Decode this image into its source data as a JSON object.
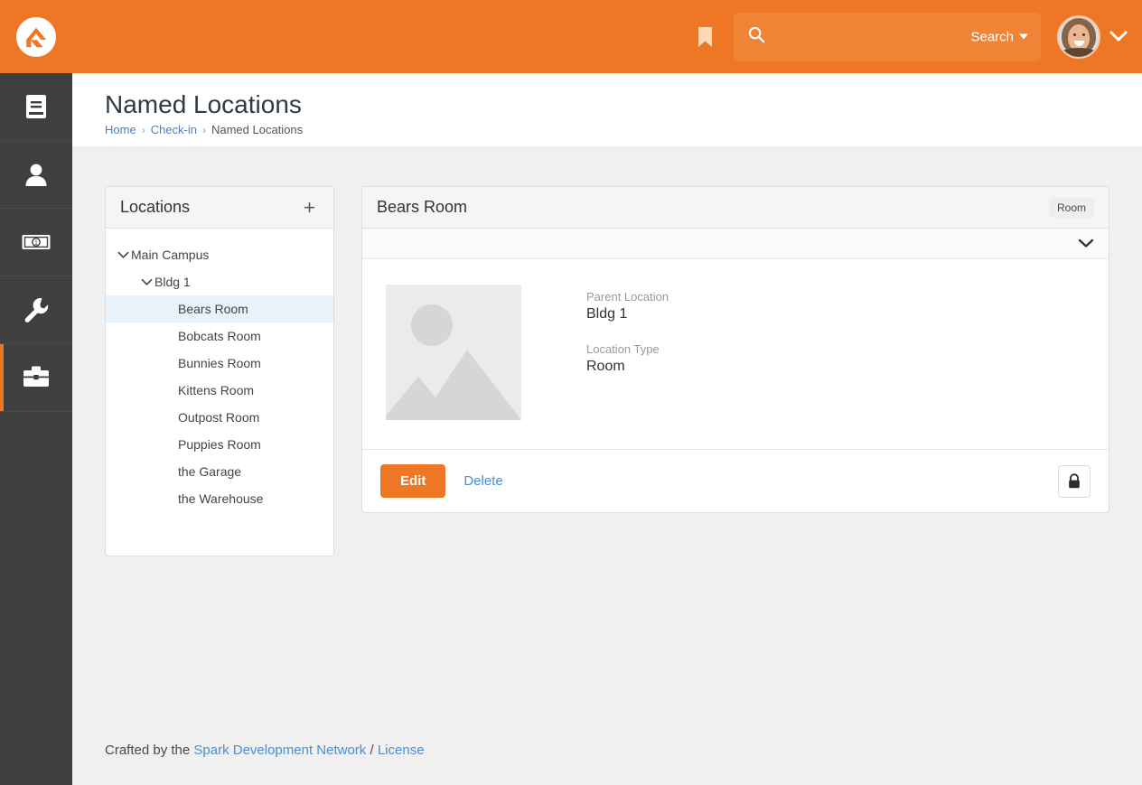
{
  "topbar": {
    "logo_icon": "rock-rms-logo",
    "bookmark_icon": "bookmark-icon",
    "search": {
      "icon": "search-icon",
      "value": "",
      "placeholder": "",
      "dropdown_label": "Search"
    },
    "avatar_alt": "user-avatar",
    "accent_color": "#ee7725",
    "search_field_color": "#ef8436"
  },
  "sidebar": {
    "items": [
      {
        "icon": "book-icon",
        "name": "dashboard",
        "active": false
      },
      {
        "icon": "person-icon",
        "name": "people",
        "active": false
      },
      {
        "icon": "money-bill-icon",
        "name": "finance",
        "active": false
      },
      {
        "icon": "wrench-icon",
        "name": "admin",
        "active": false
      },
      {
        "icon": "toolbox-icon",
        "name": "tools",
        "active": true
      }
    ]
  },
  "page": {
    "title": "Named Locations",
    "breadcrumb": [
      {
        "label": "Home",
        "link": true
      },
      {
        "label": "Check-in",
        "link": true
      },
      {
        "label": "Named Locations",
        "link": false
      }
    ],
    "breadcrumb_separator": "›"
  },
  "tree_panel": {
    "title": "Locations",
    "add_label": "+",
    "nodes": [
      {
        "label": "Main Campus",
        "level": 0,
        "expanded": true,
        "has_children": true,
        "selected": false
      },
      {
        "label": "Bldg 1",
        "level": 1,
        "expanded": true,
        "has_children": true,
        "selected": false
      },
      {
        "label": "Bears Room",
        "level": 2,
        "expanded": false,
        "has_children": false,
        "selected": true
      },
      {
        "label": "Bobcats Room",
        "level": 2,
        "expanded": false,
        "has_children": false,
        "selected": false
      },
      {
        "label": "Bunnies Room",
        "level": 2,
        "expanded": false,
        "has_children": false,
        "selected": false
      },
      {
        "label": "Kittens Room",
        "level": 2,
        "expanded": false,
        "has_children": false,
        "selected": false
      },
      {
        "label": "Outpost Room",
        "level": 2,
        "expanded": false,
        "has_children": false,
        "selected": false
      },
      {
        "label": "Puppies Room",
        "level": 2,
        "expanded": false,
        "has_children": false,
        "selected": false
      },
      {
        "label": "the Garage",
        "level": 2,
        "expanded": false,
        "has_children": false,
        "selected": false
      },
      {
        "label": "the Warehouse",
        "level": 2,
        "expanded": false,
        "has_children": false,
        "selected": false
      }
    ]
  },
  "detail_panel": {
    "title": "Bears Room",
    "badge": "Room",
    "collapse_icon": "chevron-down-icon",
    "image_placeholder_icon": "image-placeholder-icon",
    "fields": [
      {
        "label": "Parent Location",
        "value": "Bldg 1"
      },
      {
        "label": "Location Type",
        "value": "Room"
      }
    ],
    "actions": {
      "edit_label": "Edit",
      "delete_label": "Delete",
      "security_icon": "lock-icon"
    }
  },
  "footer": {
    "prefix": "Crafted by the ",
    "org_link": "Spark Development Network",
    "divider": " / ",
    "license_link": "License"
  }
}
